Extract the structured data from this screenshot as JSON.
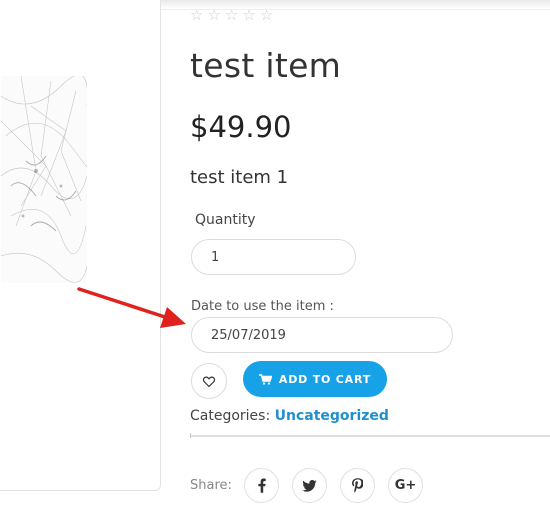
{
  "product": {
    "rating_stars": 5,
    "title": "test item",
    "price": "$49.90",
    "short_description": "test item 1"
  },
  "quantity": {
    "label": "Quantity",
    "value": "1"
  },
  "date_field": {
    "label": "Date to use the item :",
    "value": "25/07/2019"
  },
  "actions": {
    "add_to_cart_label": "ADD TO CART",
    "wishlist_icon": "heart-icon",
    "cart_icon": "cart-icon"
  },
  "meta": {
    "categories_label": "Categories:",
    "category_value": "Uncategorized"
  },
  "share": {
    "label": "Share:",
    "networks": [
      "facebook",
      "twitter",
      "pinterest",
      "google-plus"
    ],
    "gplus_glyph": "G+"
  },
  "colors": {
    "accent": "#17a1e6",
    "link": "#1f8fd0",
    "annotation_arrow": "#e0221e"
  }
}
